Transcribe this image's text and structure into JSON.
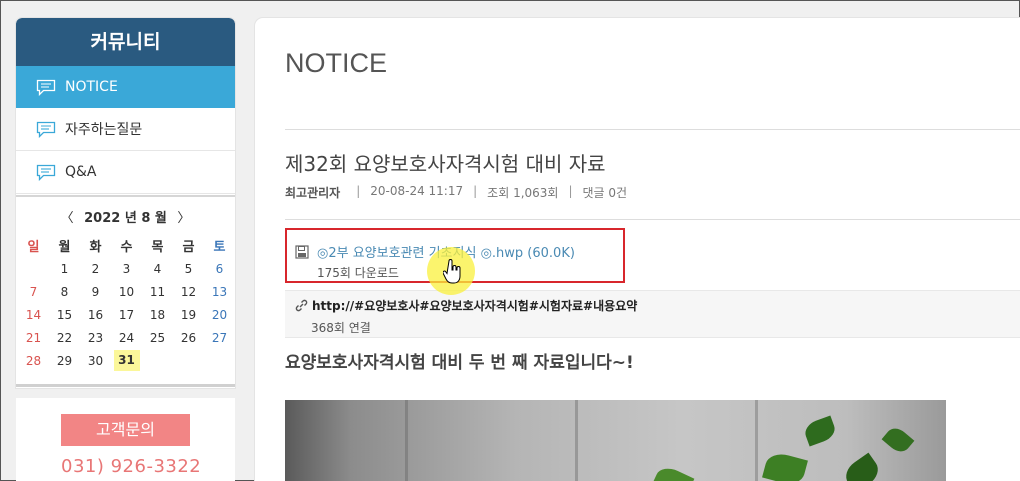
{
  "sidebar": {
    "title": "커뮤니티",
    "items": [
      {
        "label": "NOTICE",
        "active": true
      },
      {
        "label": "자주하는질문",
        "active": false
      },
      {
        "label": "Q&A",
        "active": false
      }
    ]
  },
  "calendar": {
    "prev": "〈",
    "next": "〉",
    "title": "2022 년 8 월",
    "dow": [
      "일",
      "월",
      "화",
      "수",
      "목",
      "금",
      "토"
    ],
    "weeks": [
      [
        "",
        "1",
        "2",
        "3",
        "4",
        "5",
        "6"
      ],
      [
        "7",
        "8",
        "9",
        "10",
        "11",
        "12",
        "13"
      ],
      [
        "14",
        "15",
        "16",
        "17",
        "18",
        "19",
        "20"
      ],
      [
        "21",
        "22",
        "23",
        "24",
        "25",
        "26",
        "27"
      ],
      [
        "28",
        "29",
        "30",
        "31",
        "",
        "",
        ""
      ]
    ],
    "today": "31"
  },
  "contact": {
    "button": "고객문의",
    "phone": "031) 926-3322"
  },
  "main": {
    "page_title": "NOTICE",
    "post_title": "제32회 요양보호사자격시험 대비 자료",
    "meta": {
      "author": "최고관리자",
      "date": "20-08-24 11:17",
      "views": "조회 1,063회",
      "comments": "댓글 0건"
    },
    "file": {
      "name": "◎2부 요양보호관련 기초지식 ◎.hwp (60.0K)",
      "downloads": "175회 다운로드"
    },
    "link": {
      "url": "http://#요양보호사#요양보호사자격시험#시험자료#내용요약",
      "count": "368회 연결"
    },
    "content_heading": "요양보호사자격시험 대비 두 번 째 자료입니다~!"
  },
  "colors": {
    "sidebar_header": "#2a5a80",
    "sidebar_active": "#3aa8d8",
    "highlight_box": "#d8262c",
    "contact_button": "#f28585",
    "phone_text": "#e87676",
    "file_link": "#4a8ab3"
  },
  "icons": {
    "nav_item": "speech-bubble-icon",
    "file": "floppy-disk-icon",
    "link": "chain-link-icon",
    "cursor": "hand-pointer-icon"
  }
}
